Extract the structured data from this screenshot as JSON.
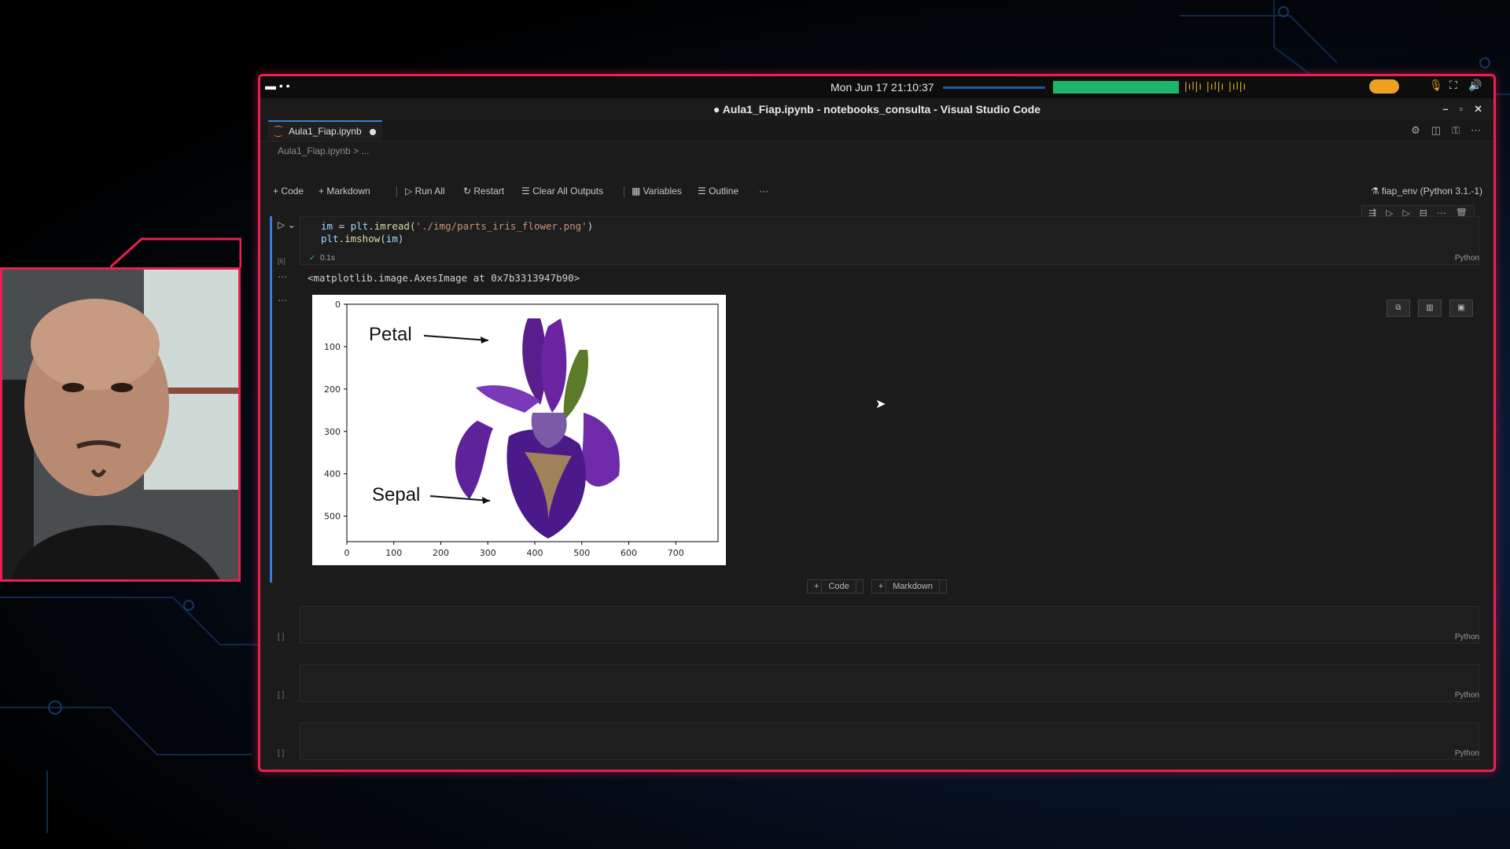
{
  "topbar": {
    "clock": "Mon Jun 17  21:10:37"
  },
  "window": {
    "title": "● Aula1_Fiap.ipynb - notebooks_consulta - Visual Studio Code"
  },
  "tab": {
    "label": "Aula1_Fiap.ipynb"
  },
  "breadcrumb": "Aula1_Fiap.ipynb > ...",
  "toolbar": {
    "code": "Code",
    "markdown": "Markdown",
    "run_all": "Run All",
    "restart": "Restart",
    "clear_outputs": "Clear All Outputs",
    "variables": "Variables",
    "outline": "Outline",
    "more": "···"
  },
  "kernel": "fiap_env (Python 3.1.-1)",
  "cell": {
    "exec_count": "[6]",
    "exec_time": "0.1s",
    "line1_var": "im",
    "line1_op": " = ",
    "line1_obj": "plt",
    "line1_fn": ".imread(",
    "line1_str": "'./img/parts_iris_flower.png'",
    "line1_close": ")",
    "line2_obj": "plt",
    "line2_fn": ".imshow(",
    "line2_arg": "im",
    "line2_close": ")",
    "language": "Python",
    "output_text": "<matplotlib.image.AxesImage at 0x7b3313947b90>"
  },
  "plot": {
    "label_petal": "Petal",
    "label_sepal": "Sepal",
    "x_ticks": [
      "0",
      "100",
      "200",
      "300",
      "400",
      "500",
      "600",
      "700"
    ],
    "y_ticks": [
      "0",
      "100",
      "200",
      "300",
      "400",
      "500"
    ]
  },
  "add_cell": {
    "code": "Code",
    "markdown": "Markdown"
  },
  "empty_cells": [
    {
      "num": "[ ]",
      "language": "Python"
    },
    {
      "num": "[ ]",
      "language": "Python"
    },
    {
      "num": "[ ]",
      "language": "Python"
    }
  ],
  "colors": {
    "accent": "#e8214f",
    "tab_active": "#3b82c4",
    "cell_focus": "#3a7bd5"
  }
}
